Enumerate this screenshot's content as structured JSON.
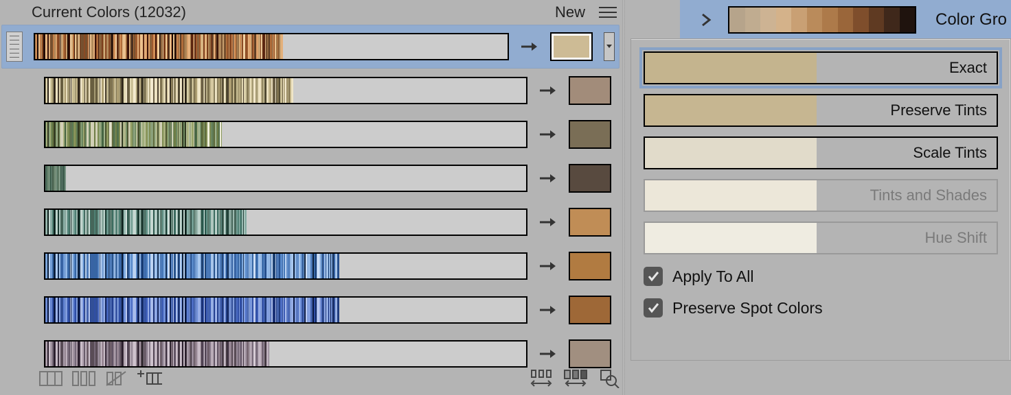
{
  "panel": {
    "title": "Current Colors (12032)",
    "new_label": "New"
  },
  "popup": {
    "options": [
      {
        "label": "Exact",
        "swatch": "#c4b48e",
        "enabled": true,
        "selected": true
      },
      {
        "label": "Preserve Tints",
        "swatch": "#c6b691",
        "enabled": true,
        "selected": false
      },
      {
        "label": "Scale Tints",
        "swatch": "#e1dbca",
        "enabled": true,
        "selected": false
      },
      {
        "label": "Tints and Shades",
        "swatch": "#ece7d9",
        "enabled": false,
        "selected": false
      },
      {
        "label": "Hue Shift",
        "swatch": "#efece1",
        "enabled": false,
        "selected": false
      }
    ],
    "apply_all_label": "Apply To All",
    "apply_all_checked": true,
    "preserve_spot_label": "Preserve Spot Colors",
    "preserve_spot_checked": true
  },
  "right": {
    "group_label": "Color Gro",
    "spectrum": [
      "#b6a48b",
      "#c0ac90",
      "#cdb393",
      "#d4b28a",
      "#c9a074",
      "#ba8b5b",
      "#ad7a4a",
      "#9a663a",
      "#7f4e2c",
      "#5f3a22",
      "#3f281b",
      "#1f130e"
    ]
  },
  "rows": [
    {
      "selected": true,
      "target": "#cdbb95",
      "palette": [
        "#1d0a05",
        "#3a1208",
        "#5b2711",
        "#7a3c1a",
        "#8a4a24",
        "#9d5a2e",
        "#b06d3a",
        "#c07d48",
        "#cf8d56",
        "#dca069",
        "#e4b07b",
        "#ebc18e",
        "#f0cfa0",
        "#e9c690",
        "#d8b582",
        "#c9a170",
        "#b28a5b",
        "#a07749",
        "#8b623b",
        "#76502f",
        "#5d3d25",
        "#4a3020"
      ],
      "density": 220
    },
    {
      "selected": false,
      "target": "#a28c7a",
      "palette": [
        "#2e251a",
        "#4b4030",
        "#6a5e45",
        "#8a7f5d",
        "#a59a73",
        "#b7ac85",
        "#c8bd94",
        "#d6cca4",
        "#e2d8b3",
        "#eadfbe",
        "#efe5c6",
        "#f3ead0",
        "#f1e6c9",
        "#e6dab6",
        "#d6c9a1",
        "#c3b58a",
        "#ae9f73",
        "#968860",
        "#7e724f",
        "#685e40",
        "#524b33",
        "#3e3827"
      ],
      "density": 220
    },
    {
      "selected": false,
      "target": "#7a6e56",
      "palette": [
        "#323a22",
        "#4b5430",
        "#5f6b3d",
        "#6f7d46",
        "#7e8c52",
        "#8a965c",
        "#9aa56c",
        "#a8b07d",
        "#b0b688",
        "#9fb28b",
        "#8aa07a",
        "#78926a",
        "#6b865f",
        "#5e7a55",
        "#52704c",
        "#466542",
        "#eeeeda",
        "#d2d0b7",
        "#bcc49f",
        "#a5b286"
      ],
      "density": 160
    },
    {
      "selected": false,
      "target": "#584a3f",
      "palette": [
        "#6f8873",
        "#5e7863",
        "#4f6854",
        "#415a47",
        "#35513f",
        "#2d4838",
        "#3a5a49",
        "#4a6a58",
        "#5b7a67",
        "#6e8b77",
        "#7f9885",
        "#8ea492",
        "#9ab09e",
        "#88a08f",
        "#759080",
        "#617e6f",
        "#4d6a5c",
        "#3e594c",
        "#324b40"
      ],
      "density": 22
    },
    {
      "selected": false,
      "target": "#c08d56",
      "palette": [
        "#0f221e",
        "#1b3c33",
        "#2a564b",
        "#3c6c60",
        "#4f8074",
        "#619085",
        "#749f95",
        "#88aea5",
        "#9bbbb3",
        "#abc6bf",
        "#bad0c9",
        "#c6d8d2",
        "#d0dfda",
        "#c2d6cf",
        "#afc7bf",
        "#9cb8af",
        "#88a69c",
        "#739286",
        "#5c7c70",
        "#46665a",
        "#304f45",
        "#1e3a32"
      ],
      "density": 180
    },
    {
      "selected": false,
      "target": "#b17b41",
      "palette": [
        "#0c1f3a",
        "#153057",
        "#1e4172",
        "#29548c",
        "#3666a4",
        "#4678b9",
        "#5889c9",
        "#6c9ad6",
        "#80abe0",
        "#94bae8",
        "#a8c7ee",
        "#bcd3f2",
        "#cddef5",
        "#bcd4f1",
        "#a7c5ea",
        "#92b5e1",
        "#7ca3d6",
        "#648fc8",
        "#4d7ab8",
        "#3864a4",
        "#264f8d",
        "#173b72"
      ],
      "density": 260
    },
    {
      "selected": false,
      "target": "#9e6837",
      "palette": [
        "#0a1840",
        "#12245c",
        "#1a3176",
        "#233f8f",
        "#2f4ea5",
        "#3d5db6",
        "#4d6ec5",
        "#5e7fd1",
        "#7090da",
        "#839fe1",
        "#96ade6",
        "#a9bceb",
        "#bbc9ef",
        "#aabfeb",
        "#97afe4",
        "#839eda",
        "#6f8ccf",
        "#5a78c0",
        "#4563ad",
        "#324f97",
        "#213c7e",
        "#132a63"
      ],
      "density": 260
    },
    {
      "selected": false,
      "target": "#a18f80",
      "palette": [
        "#2a1e2c",
        "#3c2f3e",
        "#4f4252",
        "#625565",
        "#766978",
        "#887b8a",
        "#998c9a",
        "#a89ba8",
        "#b3a6b2",
        "#bdb0bc",
        "#c6bac5",
        "#cfc3ce",
        "#d6cbd5",
        "#c9bdc7",
        "#baacb8",
        "#aa9ba7",
        "#978794",
        "#83747f",
        "#6e5f6a",
        "#594c56",
        "#463b44",
        "#352d34"
      ],
      "density": 200
    }
  ]
}
